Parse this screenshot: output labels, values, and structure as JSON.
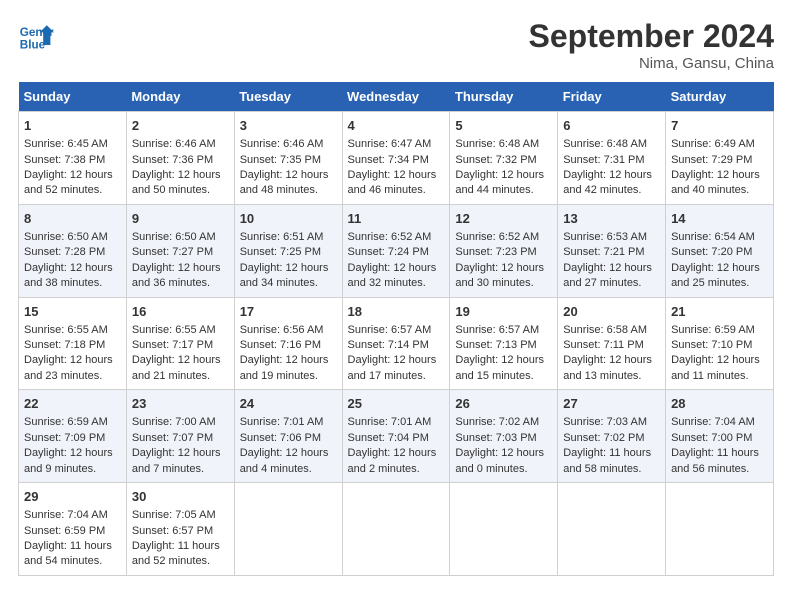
{
  "header": {
    "logo_line1": "General",
    "logo_line2": "Blue",
    "month": "September 2024",
    "location": "Nima, Gansu, China"
  },
  "weekdays": [
    "Sunday",
    "Monday",
    "Tuesday",
    "Wednesday",
    "Thursday",
    "Friday",
    "Saturday"
  ],
  "weeks": [
    [
      {
        "day": "1",
        "info": "Sunrise: 6:45 AM\nSunset: 7:38 PM\nDaylight: 12 hours\nand 52 minutes."
      },
      {
        "day": "2",
        "info": "Sunrise: 6:46 AM\nSunset: 7:36 PM\nDaylight: 12 hours\nand 50 minutes."
      },
      {
        "day": "3",
        "info": "Sunrise: 6:46 AM\nSunset: 7:35 PM\nDaylight: 12 hours\nand 48 minutes."
      },
      {
        "day": "4",
        "info": "Sunrise: 6:47 AM\nSunset: 7:34 PM\nDaylight: 12 hours\nand 46 minutes."
      },
      {
        "day": "5",
        "info": "Sunrise: 6:48 AM\nSunset: 7:32 PM\nDaylight: 12 hours\nand 44 minutes."
      },
      {
        "day": "6",
        "info": "Sunrise: 6:48 AM\nSunset: 7:31 PM\nDaylight: 12 hours\nand 42 minutes."
      },
      {
        "day": "7",
        "info": "Sunrise: 6:49 AM\nSunset: 7:29 PM\nDaylight: 12 hours\nand 40 minutes."
      }
    ],
    [
      {
        "day": "8",
        "info": "Sunrise: 6:50 AM\nSunset: 7:28 PM\nDaylight: 12 hours\nand 38 minutes."
      },
      {
        "day": "9",
        "info": "Sunrise: 6:50 AM\nSunset: 7:27 PM\nDaylight: 12 hours\nand 36 minutes."
      },
      {
        "day": "10",
        "info": "Sunrise: 6:51 AM\nSunset: 7:25 PM\nDaylight: 12 hours\nand 34 minutes."
      },
      {
        "day": "11",
        "info": "Sunrise: 6:52 AM\nSunset: 7:24 PM\nDaylight: 12 hours\nand 32 minutes."
      },
      {
        "day": "12",
        "info": "Sunrise: 6:52 AM\nSunset: 7:23 PM\nDaylight: 12 hours\nand 30 minutes."
      },
      {
        "day": "13",
        "info": "Sunrise: 6:53 AM\nSunset: 7:21 PM\nDaylight: 12 hours\nand 27 minutes."
      },
      {
        "day": "14",
        "info": "Sunrise: 6:54 AM\nSunset: 7:20 PM\nDaylight: 12 hours\nand 25 minutes."
      }
    ],
    [
      {
        "day": "15",
        "info": "Sunrise: 6:55 AM\nSunset: 7:18 PM\nDaylight: 12 hours\nand 23 minutes."
      },
      {
        "day": "16",
        "info": "Sunrise: 6:55 AM\nSunset: 7:17 PM\nDaylight: 12 hours\nand 21 minutes."
      },
      {
        "day": "17",
        "info": "Sunrise: 6:56 AM\nSunset: 7:16 PM\nDaylight: 12 hours\nand 19 minutes."
      },
      {
        "day": "18",
        "info": "Sunrise: 6:57 AM\nSunset: 7:14 PM\nDaylight: 12 hours\nand 17 minutes."
      },
      {
        "day": "19",
        "info": "Sunrise: 6:57 AM\nSunset: 7:13 PM\nDaylight: 12 hours\nand 15 minutes."
      },
      {
        "day": "20",
        "info": "Sunrise: 6:58 AM\nSunset: 7:11 PM\nDaylight: 12 hours\nand 13 minutes."
      },
      {
        "day": "21",
        "info": "Sunrise: 6:59 AM\nSunset: 7:10 PM\nDaylight: 12 hours\nand 11 minutes."
      }
    ],
    [
      {
        "day": "22",
        "info": "Sunrise: 6:59 AM\nSunset: 7:09 PM\nDaylight: 12 hours\nand 9 minutes."
      },
      {
        "day": "23",
        "info": "Sunrise: 7:00 AM\nSunset: 7:07 PM\nDaylight: 12 hours\nand 7 minutes."
      },
      {
        "day": "24",
        "info": "Sunrise: 7:01 AM\nSunset: 7:06 PM\nDaylight: 12 hours\nand 4 minutes."
      },
      {
        "day": "25",
        "info": "Sunrise: 7:01 AM\nSunset: 7:04 PM\nDaylight: 12 hours\nand 2 minutes."
      },
      {
        "day": "26",
        "info": "Sunrise: 7:02 AM\nSunset: 7:03 PM\nDaylight: 12 hours\nand 0 minutes."
      },
      {
        "day": "27",
        "info": "Sunrise: 7:03 AM\nSunset: 7:02 PM\nDaylight: 11 hours\nand 58 minutes."
      },
      {
        "day": "28",
        "info": "Sunrise: 7:04 AM\nSunset: 7:00 PM\nDaylight: 11 hours\nand 56 minutes."
      }
    ],
    [
      {
        "day": "29",
        "info": "Sunrise: 7:04 AM\nSunset: 6:59 PM\nDaylight: 11 hours\nand 54 minutes."
      },
      {
        "day": "30",
        "info": "Sunrise: 7:05 AM\nSunset: 6:57 PM\nDaylight: 11 hours\nand 52 minutes."
      },
      null,
      null,
      null,
      null,
      null
    ]
  ]
}
